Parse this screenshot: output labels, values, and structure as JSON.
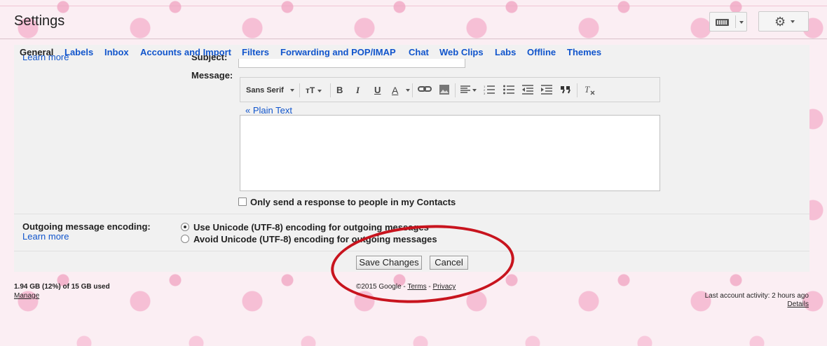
{
  "header": {
    "title": "Settings",
    "keyboard_icon": "keyboard-icon",
    "settings_icon": "gear-icon"
  },
  "tabs": [
    {
      "label": "General",
      "active": true
    },
    {
      "label": "Labels"
    },
    {
      "label": "Inbox"
    },
    {
      "label": "Accounts and Import"
    },
    {
      "label": "Filters"
    },
    {
      "label": "Forwarding and POP/IMAP"
    },
    {
      "label": "Chat"
    },
    {
      "label": "Web Clips"
    },
    {
      "label": "Labs"
    },
    {
      "label": "Offline"
    },
    {
      "label": "Themes"
    }
  ],
  "vacation": {
    "learn_more": "Learn more",
    "subject_label": "Subject:",
    "message_label": "Message:",
    "toolbar": {
      "font": "Sans Serif",
      "size_icon": "font-size-icon",
      "bold": "B",
      "italic": "I",
      "underline": "U",
      "text_color": "A"
    },
    "plain_text_link": "« Plain Text",
    "contacts_only_label": "Only send a response to people in my Contacts"
  },
  "encoding": {
    "label": "Outgoing message encoding:",
    "learn_more": "Learn more",
    "option_unicode": "Use Unicode (UTF-8) encoding for outgoing messages",
    "option_avoid": "Avoid Unicode (UTF-8) encoding for outgoing messages",
    "selected": "Use Unicode (UTF-8) encoding for outgoing messages"
  },
  "actions": {
    "save": "Save Changes",
    "cancel": "Cancel"
  },
  "footer": {
    "storage": "1.94 GB (12%) of 15 GB used",
    "manage": "Manage",
    "copyright": "©2015 Google - ",
    "terms": "Terms",
    "sep": " - ",
    "privacy": "Privacy",
    "activity": "Last account activity: 2 hours ago",
    "details": "Details"
  },
  "colors": {
    "link": "#1155cc",
    "highlight": "#c8141e"
  }
}
